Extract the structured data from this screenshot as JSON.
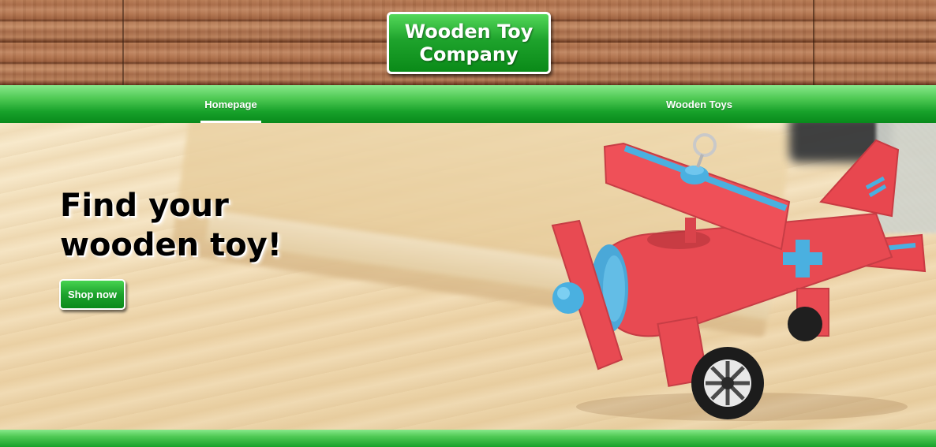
{
  "header": {
    "logo_line1": "Wooden Toy",
    "logo_line2": "Company"
  },
  "nav": {
    "items": [
      {
        "label": "Homepage",
        "active": true
      },
      {
        "label": "Wooden Toys",
        "active": false
      }
    ]
  },
  "hero": {
    "title_line1": "Find your",
    "title_line2": "wooden toy!",
    "cta_label": "Shop now",
    "image_icon": "toy-airplane"
  },
  "colors": {
    "brand_green": "#1ea32c",
    "nav_active_underline": "#ffffff",
    "plane_red": "#e84a52",
    "plane_blue": "#4ab0e0"
  }
}
